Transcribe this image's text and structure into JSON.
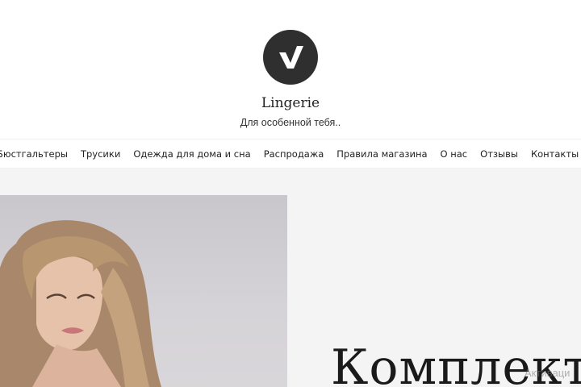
{
  "site": {
    "title": "Lingerie",
    "tagline": "Для особенной тебя..",
    "logo_icon": "checkmark-v-icon"
  },
  "nav": {
    "items": [
      "Бюстгальтеры",
      "Трусики",
      "Одежда для дома и сна",
      "Распродажа",
      "Правила магазина",
      "О нас",
      "Отзывы",
      "Контакты"
    ]
  },
  "hero": {
    "title": "Комплект",
    "image": "woman-portrait-photo"
  },
  "watermark": "Активаци",
  "colors": {
    "logo_bg": "#2f2f2f",
    "hero_bg": "#f4f4f4",
    "text": "#222222"
  }
}
